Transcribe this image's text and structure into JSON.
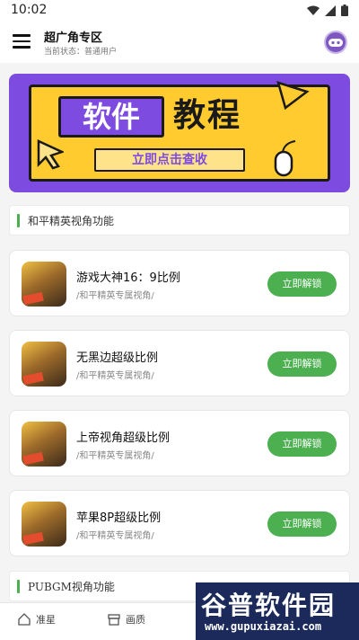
{
  "status": {
    "time": "10:02"
  },
  "header": {
    "title": "超广角专区",
    "subtitle": "当前状态：普通用户"
  },
  "banner": {
    "chip": "软件",
    "big": "教程",
    "button": "立即点击查收"
  },
  "sections": [
    {
      "label": "和平精英视角功能"
    },
    {
      "label": "PUBGM视角功能"
    }
  ],
  "items": [
    {
      "name": "游戏大神16：9比例",
      "desc": "/和平精英专属视角/",
      "button": "立即解锁"
    },
    {
      "name": "无黑边超级比例",
      "desc": "/和平精英专属视角/",
      "button": "立即解锁"
    },
    {
      "name": "上帝视角超级比例",
      "desc": "/和平精英专属视角/",
      "button": "立即解锁"
    },
    {
      "name": "苹果8P超级比例",
      "desc": "/和平精英专属视角/",
      "button": "立即解锁"
    }
  ],
  "nav": {
    "item1": "准星",
    "item2": "画质"
  },
  "watermark": {
    "brand": "谷普软件园",
    "url": "www.gupuxiazai.com"
  },
  "colors": {
    "accent": "#4caf50",
    "banner": "#7d4be0",
    "banner_yellow": "#ffcb2e"
  }
}
